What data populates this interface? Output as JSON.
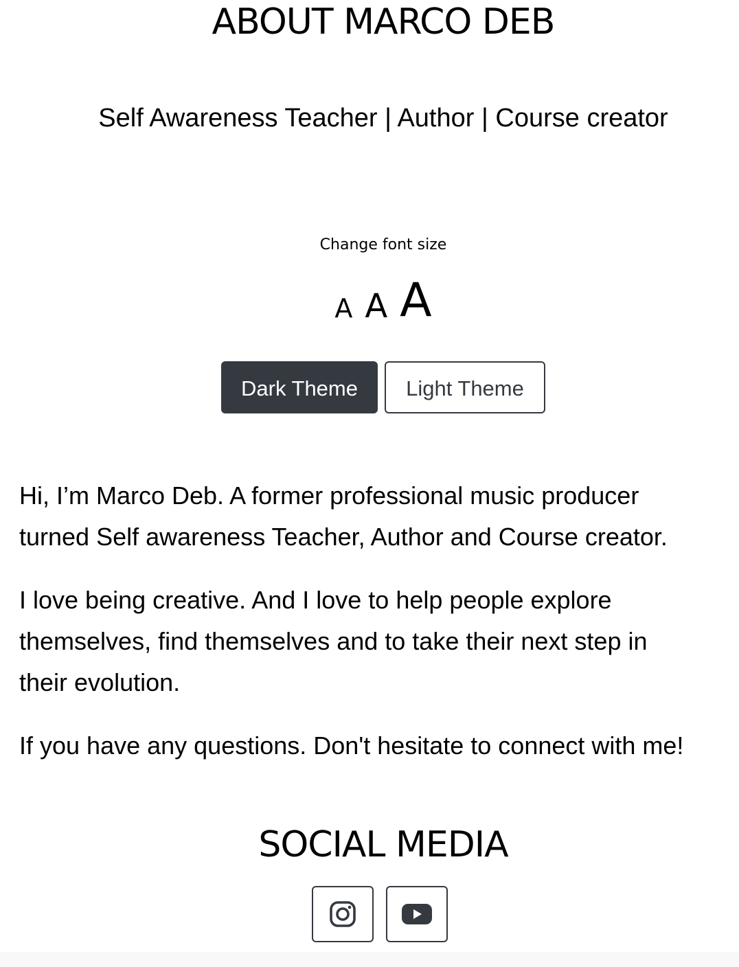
{
  "header": {
    "title": "ABOUT MARCO DEB",
    "subtitle": "Self Awareness Teacher | Author | Course creator"
  },
  "font_size": {
    "label": "Change font size",
    "small": "A",
    "medium": "A",
    "large": "A"
  },
  "theme": {
    "dark_label": "Dark Theme",
    "light_label": "Light Theme",
    "selected": "Dark Theme"
  },
  "about": {
    "paragraph_1": "Hi, I’m Marco Deb. A former professional music producer\nturned Self awareness Teacher, Author and Course creator.",
    "paragraph_2": "I love being creative. And I love to help people explore\nthemselves, find themselves and to take their next step in\ntheir evolution.",
    "paragraph_3": "If you have any questions. Don't hesitate to connect with me!"
  },
  "social": {
    "title": "SOCIAL MEDIA",
    "icons": [
      "instagram-icon",
      "youtube-icon"
    ]
  },
  "colors": {
    "dark_button": "#343a40",
    "text": "#000000",
    "background": "#ffffff"
  }
}
